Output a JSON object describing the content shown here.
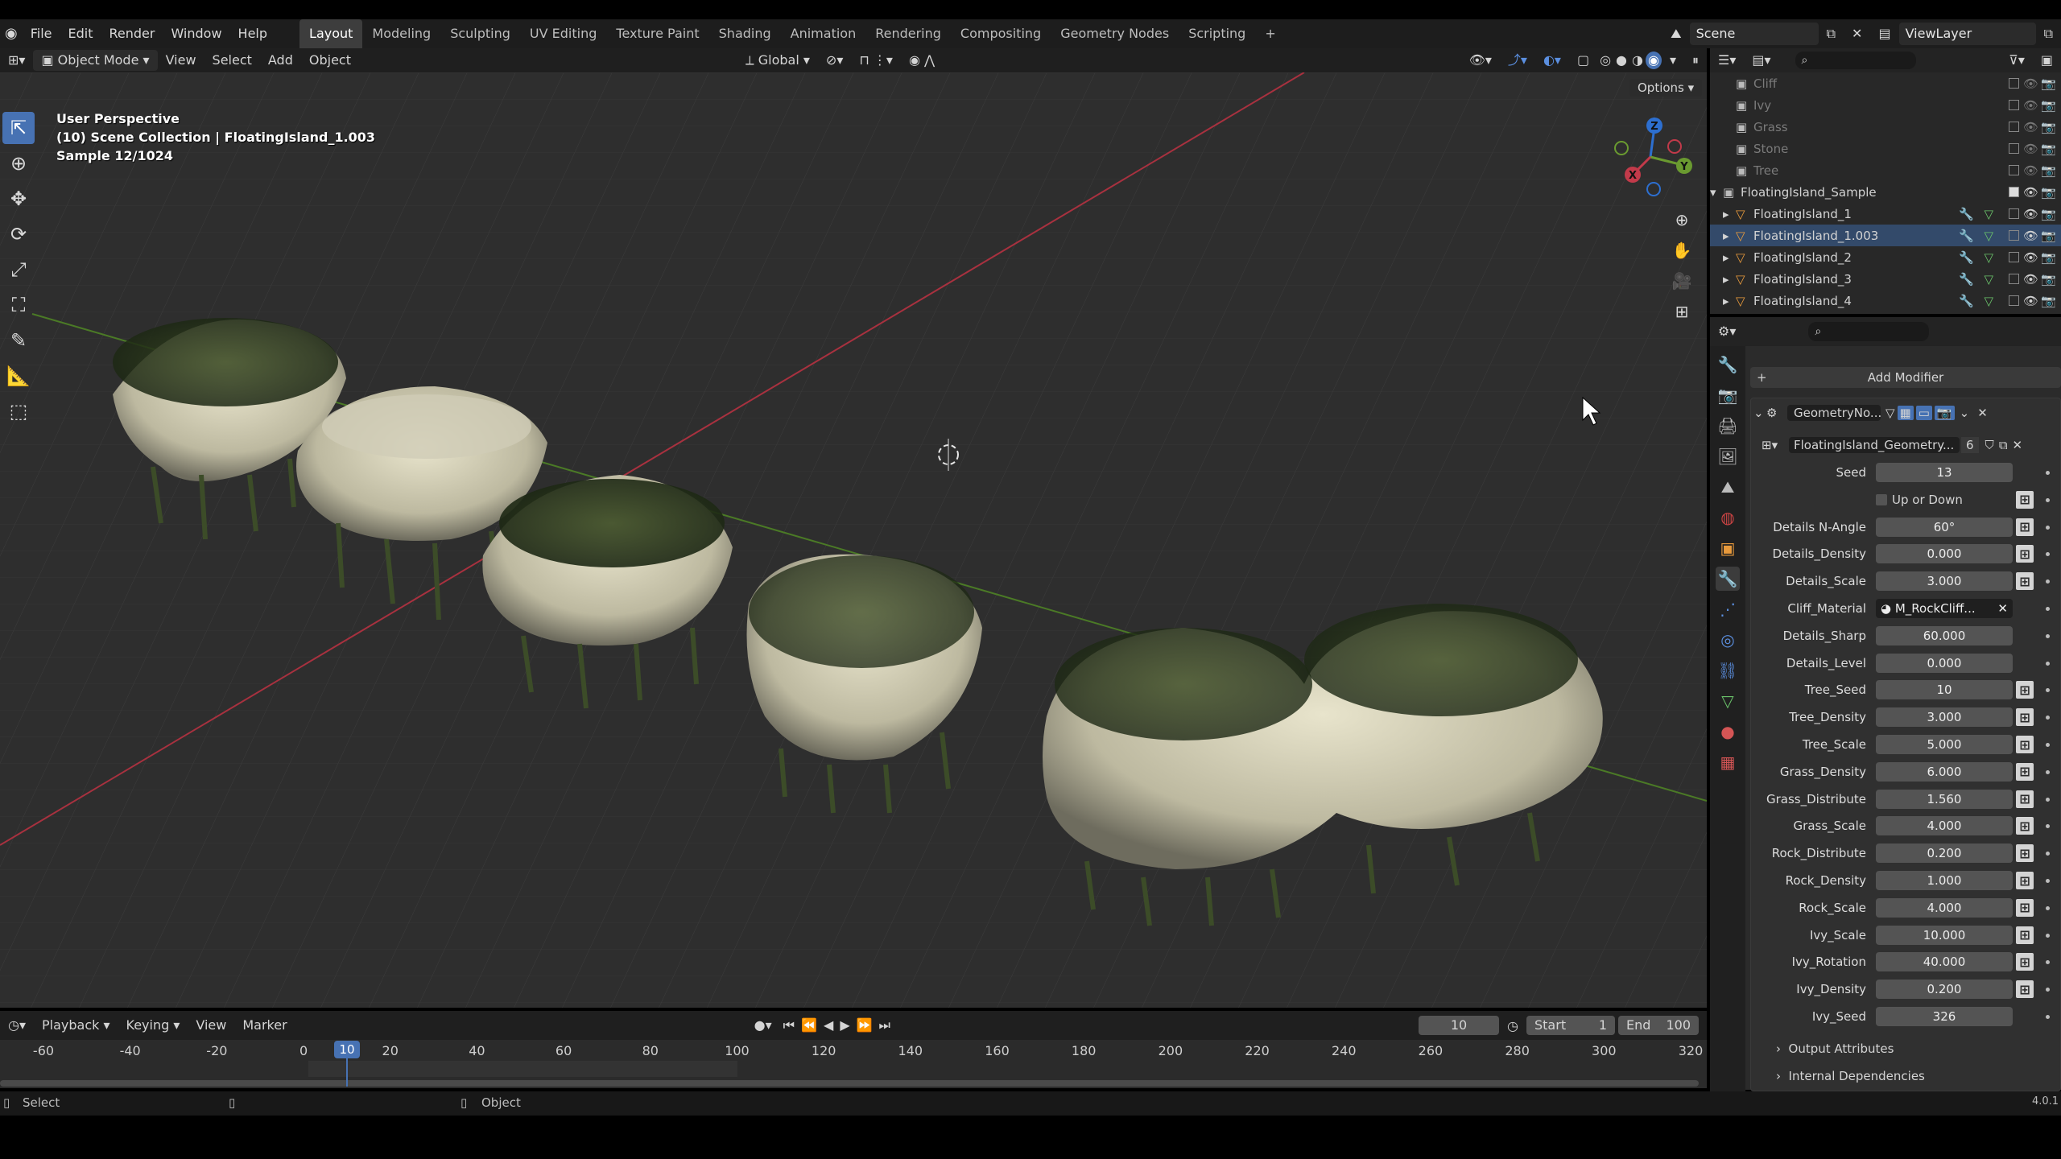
{
  "menu": {
    "items": [
      "File",
      "Edit",
      "Render",
      "Window",
      "Help"
    ]
  },
  "workspaces": {
    "tabs": [
      "Layout",
      "Modeling",
      "Sculpting",
      "UV Editing",
      "Texture Paint",
      "Shading",
      "Animation",
      "Rendering",
      "Compositing",
      "Geometry Nodes",
      "Scripting"
    ],
    "active": "Layout",
    "add": "+"
  },
  "scene": {
    "name": "Scene",
    "view_layer": "ViewLayer"
  },
  "viewport_header": {
    "mode": "Object Mode",
    "menus": [
      "View",
      "Select",
      "Add",
      "Object"
    ],
    "transform_orientation": "Global",
    "options": "Options"
  },
  "viewport": {
    "perspective": "User Perspective",
    "collection": "(10) Scene Collection | FloatingIsland_1.003",
    "sample": "Sample 12/1024",
    "gizmo_axes": {
      "z": "Z",
      "y": "Y",
      "x": "X"
    }
  },
  "outliner": {
    "rows": [
      {
        "name": "Cliff",
        "dim": true
      },
      {
        "name": "Ivy",
        "dim": true
      },
      {
        "name": "Grass",
        "dim": true
      },
      {
        "name": "Stone",
        "dim": true
      },
      {
        "name": "Tree",
        "dim": true
      },
      {
        "name": "FloatingIsland_Sample",
        "dim": false
      },
      {
        "name": "FloatingIsland_1",
        "dim": false
      },
      {
        "name": "FloatingIsland_1.003",
        "dim": false
      },
      {
        "name": "FloatingIsland_2",
        "dim": false
      },
      {
        "name": "FloatingIsland_3",
        "dim": false
      },
      {
        "name": "FloatingIsland_4",
        "dim": false
      }
    ]
  },
  "properties": {
    "add_modifier": "Add Modifier",
    "modifier_name": "GeometryNo...",
    "node_group": "FloatingIsland_Geometry...",
    "node_group_users": "6",
    "params": [
      {
        "label": "Seed",
        "value": "13",
        "btn": false
      },
      {
        "label": "Up or Down",
        "value": "",
        "btn": true,
        "checkbox": true
      },
      {
        "label": "Details N-Angle",
        "value": "60°",
        "btn": true
      },
      {
        "label": "Details_Density",
        "value": "0.000",
        "btn": true
      },
      {
        "label": "Details_Scale",
        "value": "3.000",
        "btn": true
      },
      {
        "label": "Cliff_Material",
        "value": "M_RockCliff...",
        "btn": false,
        "material": true
      },
      {
        "label": "Details_Sharp",
        "value": "60.000",
        "btn": false
      },
      {
        "label": "Details_Level",
        "value": "0.000",
        "btn": false
      },
      {
        "label": "Tree_Seed",
        "value": "10",
        "btn": true
      },
      {
        "label": "Tree_Density",
        "value": "3.000",
        "btn": true
      },
      {
        "label": "Tree_Scale",
        "value": "5.000",
        "btn": true
      },
      {
        "label": "Grass_Density",
        "value": "6.000",
        "btn": true
      },
      {
        "label": "Grass_Distribute",
        "value": "1.560",
        "btn": true
      },
      {
        "label": "Grass_Scale",
        "value": "4.000",
        "btn": true
      },
      {
        "label": "Rock_Distribute",
        "value": "0.200",
        "btn": true
      },
      {
        "label": "Rock_Density",
        "value": "1.000",
        "btn": true
      },
      {
        "label": "Rock_Scale",
        "value": "4.000",
        "btn": true
      },
      {
        "label": "Ivy_Scale",
        "value": "10.000",
        "btn": true
      },
      {
        "label": "Ivy_Rotation",
        "value": "40.000",
        "btn": true
      },
      {
        "label": "Ivy_Density",
        "value": "0.200",
        "btn": true
      },
      {
        "label": "Ivy_Seed",
        "value": "326",
        "btn": false
      }
    ],
    "output_attributes": "Output Attributes",
    "internal_dependencies": "Internal Dependencies"
  },
  "timeline": {
    "menus": [
      "Playback",
      "Keying",
      "View",
      "Marker"
    ],
    "current_frame": "10",
    "start_label": "Start",
    "start": "1",
    "end_label": "End",
    "end": "100",
    "ticks": [
      "-60",
      "-40",
      "-20",
      "0",
      "20",
      "40",
      "60",
      "80",
      "100",
      "120",
      "140",
      "160",
      "180",
      "200",
      "220",
      "240",
      "260",
      "280",
      "300",
      "320"
    ],
    "playhead": "10"
  },
  "statusbar": {
    "left": "Select",
    "middle": "Object",
    "version": "4.0.1"
  },
  "colors": {
    "accent": "#4772b3",
    "x_axis": "#c23a4a",
    "y_axis": "#6a9a30",
    "z_axis": "#2d6fd0"
  }
}
